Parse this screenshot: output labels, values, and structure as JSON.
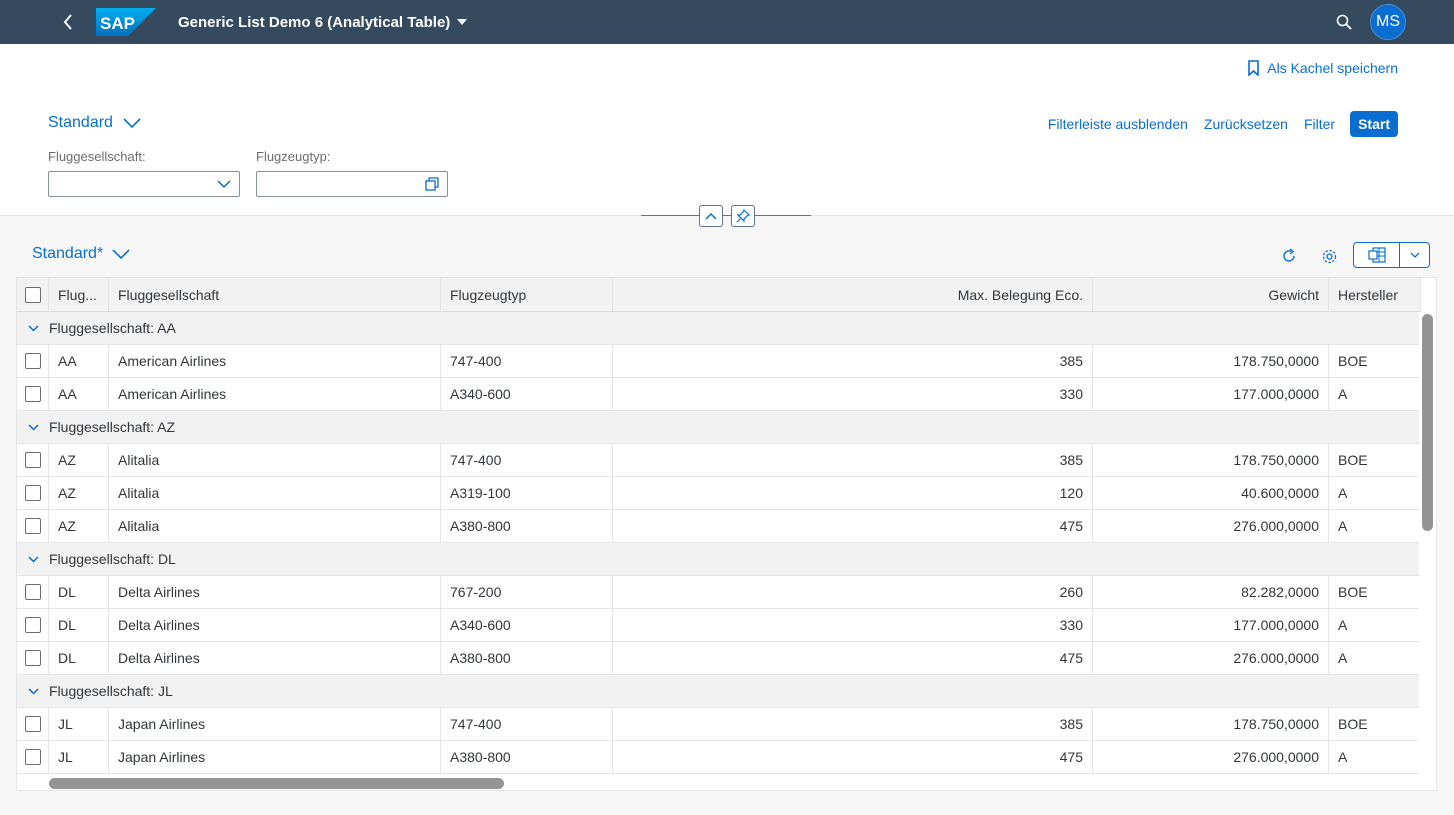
{
  "shell": {
    "logo_text": "SAP",
    "app_title": "Generic List Demo 6 (Analytical Table)",
    "avatar_initials": "MS",
    "brand_color": "#354a5f",
    "accent_color": "#0a6ed1"
  },
  "header": {
    "save_tile_label": "Als Kachel speichern",
    "variant_label": "Standard",
    "actions": {
      "hide_filter_bar": "Filterleiste ausblenden",
      "reset": "Zurücksetzen",
      "filter": "Filter",
      "start": "Start"
    },
    "filters": [
      {
        "label": "Fluggesellschaft:",
        "value": "",
        "icon": "chevron-down-icon"
      },
      {
        "label": "Flugzeugtyp:",
        "value": "",
        "icon": "value-help-icon"
      }
    ]
  },
  "table": {
    "variant_label": "Standard*",
    "columns": [
      "Flug...",
      "Fluggesellschaft",
      "Flugzeugtyp",
      "Max. Belegung Eco.",
      "Gewicht",
      "Hersteller"
    ],
    "groups": [
      {
        "label": "Fluggesellschaft: AA",
        "rows": [
          [
            "AA",
            "American Airlines",
            "747-400",
            "385",
            "178.750,0000",
            "BOE"
          ],
          [
            "AA",
            "American Airlines",
            "A340-600",
            "330",
            "177.000,0000",
            "A"
          ]
        ]
      },
      {
        "label": "Fluggesellschaft: AZ",
        "rows": [
          [
            "AZ",
            "Alitalia",
            "747-400",
            "385",
            "178.750,0000",
            "BOE"
          ],
          [
            "AZ",
            "Alitalia",
            "A319-100",
            "120",
            "40.600,0000",
            "A"
          ],
          [
            "AZ",
            "Alitalia",
            "A380-800",
            "475",
            "276.000,0000",
            "A"
          ]
        ]
      },
      {
        "label": "Fluggesellschaft: DL",
        "rows": [
          [
            "DL",
            "Delta Airlines",
            "767-200",
            "260",
            "82.282,0000",
            "BOE"
          ],
          [
            "DL",
            "Delta Airlines",
            "A340-600",
            "330",
            "177.000,0000",
            "A"
          ],
          [
            "DL",
            "Delta Airlines",
            "A380-800",
            "475",
            "276.000,0000",
            "A"
          ]
        ]
      },
      {
        "label": "Fluggesellschaft: JL",
        "rows": [
          [
            "JL",
            "Japan Airlines",
            "747-400",
            "385",
            "178.750,0000",
            "BOE"
          ],
          [
            "JL",
            "Japan Airlines",
            "A380-800",
            "475",
            "276.000,0000",
            "A"
          ]
        ]
      }
    ]
  }
}
